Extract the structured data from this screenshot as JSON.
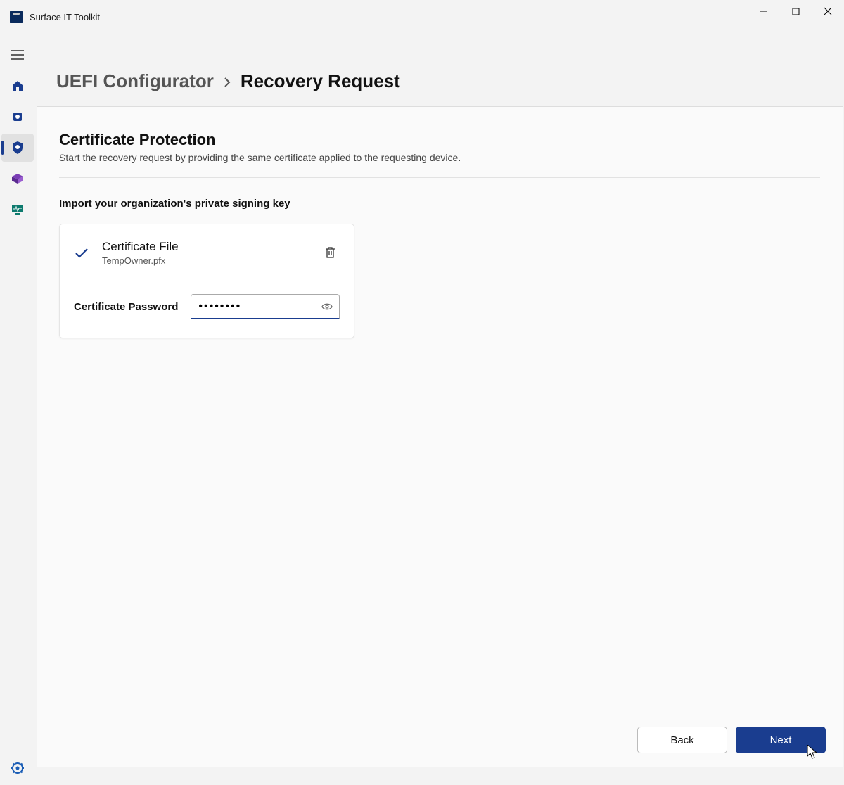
{
  "app": {
    "title": "Surface IT Toolkit"
  },
  "breadcrumb": {
    "parent": "UEFI Configurator",
    "current": "Recovery Request"
  },
  "section": {
    "title": "Certificate Protection",
    "description": "Start the recovery request by providing the same certificate applied to the requesting device.",
    "import_heading": "Import your organization's private signing key"
  },
  "certificate": {
    "file_label": "Certificate File",
    "file_name": "TempOwner.pfx",
    "password_label": "Certificate Password",
    "password_value": "••••••••"
  },
  "buttons": {
    "back": "Back",
    "next": "Next"
  },
  "colors": {
    "accent": "#1a3d8f"
  }
}
